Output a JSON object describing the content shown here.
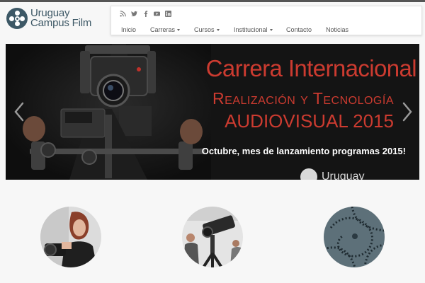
{
  "brand": {
    "line1": "Uruguay",
    "line2": "Campus Film",
    "color": "#3d5866"
  },
  "social": [
    {
      "icon": "rss-icon"
    },
    {
      "icon": "twitter-icon"
    },
    {
      "icon": "facebook-icon"
    },
    {
      "icon": "youtube-icon"
    },
    {
      "icon": "linkedin-icon"
    }
  ],
  "nav": {
    "items": [
      {
        "label": "Inicio",
        "dropdown": false
      },
      {
        "label": "Carreras",
        "dropdown": true
      },
      {
        "label": "Cursos",
        "dropdown": true
      },
      {
        "label": "Institucional",
        "dropdown": true
      },
      {
        "label": "Contacto",
        "dropdown": false
      },
      {
        "label": "Noticias",
        "dropdown": false
      }
    ]
  },
  "slider": {
    "title": "Carrera Internacional",
    "subtitle": "Realización y Tecnología",
    "subtitle2": "AUDIOVISUAL 2015",
    "caption": "Octubre, mes de lanzamiento programas 2015!",
    "brand_partial": "Uruguay",
    "accent": "#cc3b30",
    "prev_icon": "chevron-left-icon",
    "next_icon": "chevron-right-icon"
  },
  "features": [
    {
      "image": "photographer-with-camera"
    },
    {
      "image": "film-camera-crew"
    },
    {
      "image": "film-reel-pattern"
    }
  ]
}
